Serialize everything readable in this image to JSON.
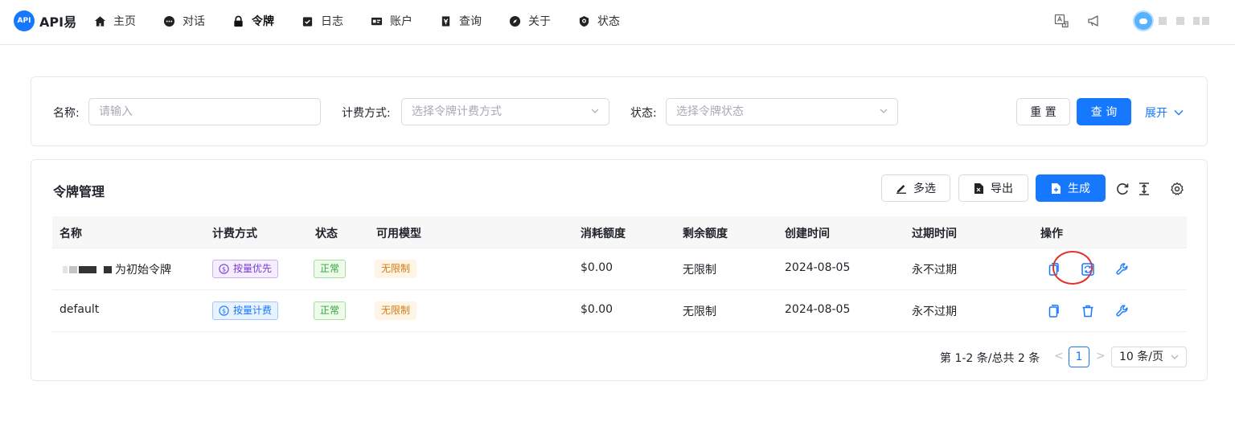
{
  "brand": {
    "logo_text": "API",
    "name": "API易"
  },
  "nav": {
    "items": [
      {
        "label": "主页",
        "icon": "home-icon"
      },
      {
        "label": "对话",
        "icon": "chat-icon"
      },
      {
        "label": "令牌",
        "icon": "lock-icon",
        "active": true
      },
      {
        "label": "日志",
        "icon": "log-icon"
      },
      {
        "label": "账户",
        "icon": "account-icon"
      },
      {
        "label": "查询",
        "icon": "query-icon"
      },
      {
        "label": "关于",
        "icon": "compass-icon"
      },
      {
        "label": "状态",
        "icon": "status-icon"
      }
    ]
  },
  "filters": {
    "name_label": "名称:",
    "name_placeholder": "请输入",
    "billing_label": "计费方式:",
    "billing_placeholder": "选择令牌计费方式",
    "status_label": "状态:",
    "status_placeholder": "选择令牌状态",
    "reset_label": "重 置",
    "query_label": "查 询",
    "expand_label": "展开"
  },
  "table_card": {
    "title": "令牌管理",
    "multi_select_label": "多选",
    "export_label": "导出",
    "generate_label": "生成"
  },
  "table": {
    "columns": [
      "名称",
      "计费方式",
      "状态",
      "可用模型",
      "消耗额度",
      "剩余额度",
      "创建时间",
      "过期时间",
      "操作"
    ],
    "rows": [
      {
        "name": "为初始令牌",
        "billing": "按量优先",
        "billing_style": "purple",
        "status": "正常",
        "models": "无限制",
        "used": "$0.00",
        "remaining": "无限制",
        "created": "2024-08-05",
        "expires": "永不过期",
        "middle_action": "refresh-icon"
      },
      {
        "name": "default",
        "billing": "按量计费",
        "billing_style": "blue",
        "status": "正常",
        "models": "无限制",
        "used": "$0.00",
        "remaining": "无限制",
        "created": "2024-08-05",
        "expires": "永不过期",
        "middle_action": "trash-icon"
      }
    ]
  },
  "pagination": {
    "summary": "第 1-2 条/总共 2 条",
    "prev": "<",
    "current": "1",
    "next": ">",
    "page_size": "10 条/页"
  },
  "colors": {
    "primary": "#1677ff",
    "highlight_circle": "#e2322a"
  }
}
